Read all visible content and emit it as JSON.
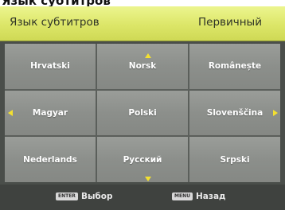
{
  "page": {
    "title": "Язык субтитров"
  },
  "header": {
    "label": "Язык субтитров",
    "value": "Первичный"
  },
  "languages": [
    "Hrvatski",
    "Norsk",
    "Românește",
    "Magyar",
    "Polski",
    "Slovenščina",
    "Nederlands",
    "Русский",
    "Srpski"
  ],
  "footer": {
    "enter_key": "ENTER",
    "enter_label": "Выбор",
    "menu_key": "MENU",
    "menu_label": "Назад"
  },
  "colors": {
    "header_bg": "#dce668",
    "panel_bg": "#4a4e4a",
    "cell_bg": "#8c8f8b",
    "arrow": "#f3e030"
  },
  "icons": [
    "arrow-up-icon",
    "arrow-down-icon",
    "arrow-left-icon",
    "arrow-right-icon",
    "enter-key-icon",
    "menu-key-icon"
  ]
}
